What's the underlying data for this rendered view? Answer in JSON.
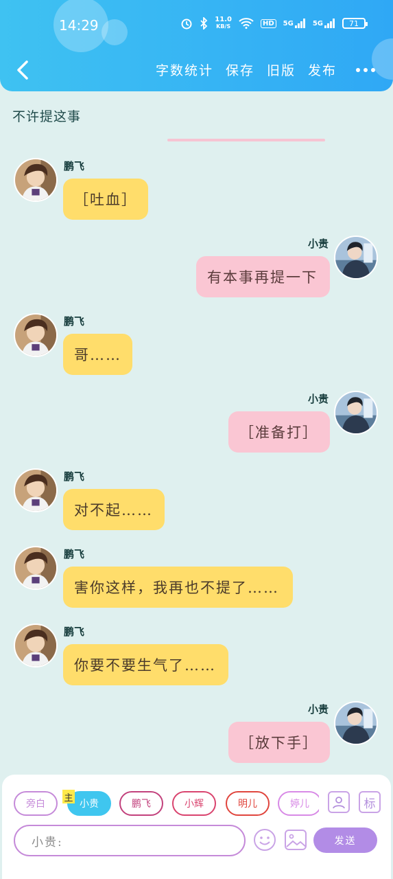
{
  "status_bar": {
    "time": "14:29",
    "net_speed_value": "11.0",
    "net_speed_unit": "KB/S",
    "hd_label": "HD",
    "signal_1": "5G",
    "signal_2": "5G",
    "battery": "71"
  },
  "toolbar": {
    "word_count": "字数统计",
    "save": "保存",
    "old_version": "旧版",
    "publish": "发布"
  },
  "chat": {
    "title": "不许提这事",
    "messages": [
      {
        "side": "left",
        "name": "鹏飞",
        "text": "［吐血］"
      },
      {
        "side": "right",
        "name": "小贵",
        "text": "有本事再提一下"
      },
      {
        "side": "left",
        "name": "鹏飞",
        "text": "哥……"
      },
      {
        "side": "right",
        "name": "小贵",
        "text": "［准备打］"
      },
      {
        "side": "left",
        "name": "鹏飞",
        "text": "对不起……"
      },
      {
        "side": "left",
        "name": "鹏飞",
        "text": "害你这样，我再也不提了……"
      },
      {
        "side": "left",
        "name": "鹏飞",
        "text": "你要不要生气了……"
      },
      {
        "side": "right",
        "name": "小贵",
        "text": "［放下手］"
      }
    ]
  },
  "composer": {
    "main_tag": "主",
    "roles": [
      {
        "label": "旁白",
        "color": "#c58ad9"
      },
      {
        "label": "小贵",
        "color": "#3fc6ef",
        "active": true
      },
      {
        "label": "鹏飞",
        "color": "#c2417c"
      },
      {
        "label": "小辉",
        "color": "#d9436e"
      },
      {
        "label": "明儿",
        "color": "#e0453d"
      },
      {
        "label": "婷儿",
        "color": "#d88ae6"
      }
    ],
    "mark_label": "标",
    "input_value": "小贵:",
    "send_label": "发送"
  },
  "colors": {
    "header": "#2fa8f5",
    "left_bubble": "#ffdd6b",
    "right_bubble": "#fac6d3",
    "background": "#dff0ef",
    "send_button": "#b28ce6"
  }
}
